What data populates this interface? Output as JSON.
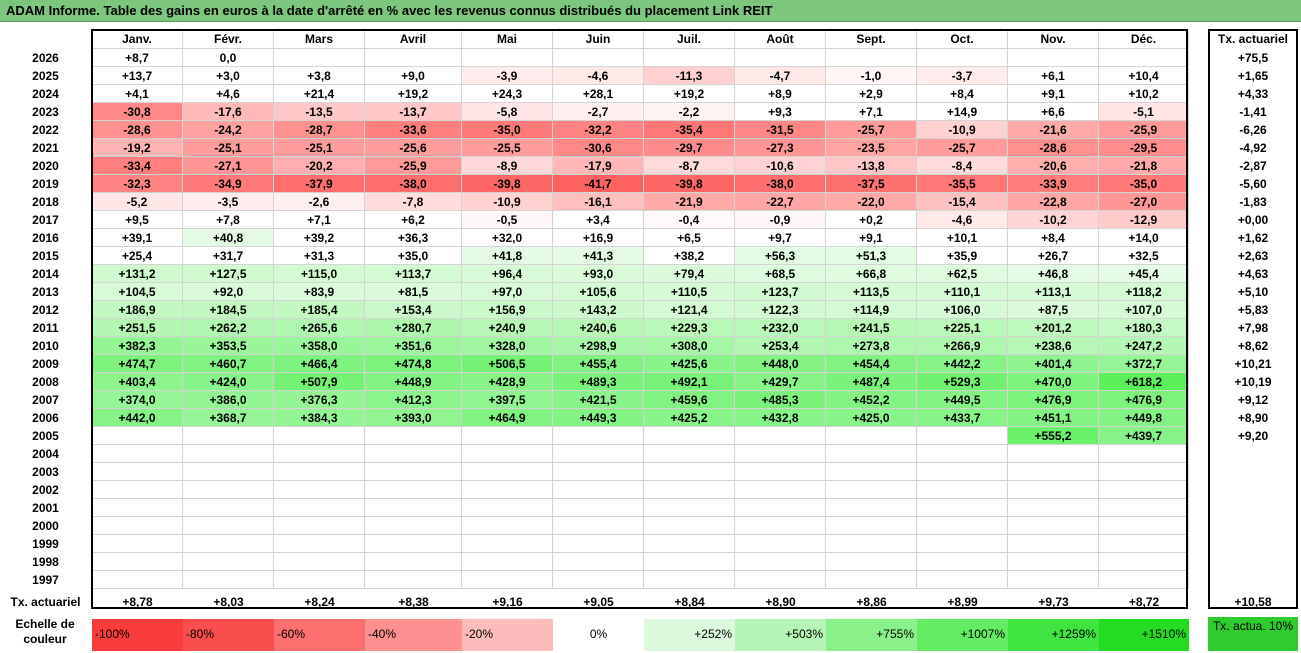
{
  "title": "ADAM Informe. Table des gains en euros à la date d'arrêté en % avec les revenus connus distribués du placement Link REIT",
  "months": [
    "Janv.",
    "Févr.",
    "Mars",
    "Avril",
    "Mai",
    "Juin",
    "Juil.",
    "Août",
    "Sept.",
    "Oct.",
    "Nov.",
    "Déc."
  ],
  "actuarial_header": "Tx. actuariel",
  "row_footer_label": "Tx. actuariel",
  "footer_values": [
    "+8,78",
    "+8,03",
    "+8,24",
    "+8,38",
    "+9,16",
    "+9,05",
    "+8,84",
    "+8,90",
    "+8,86",
    "+8,99",
    "+9,73",
    "+8,72"
  ],
  "footer_actuarial": "+10,58",
  "scale_label": "Echelle de couleur",
  "scale": [
    {
      "label": "-100%",
      "color": "#f83b3b",
      "align": "left"
    },
    {
      "label": "-80%",
      "color": "#fa4e4e",
      "align": "left"
    },
    {
      "label": "-60%",
      "color": "#fb6f6f",
      "align": "left"
    },
    {
      "label": "-40%",
      "color": "#fc8f8f",
      "align": "left"
    },
    {
      "label": "-20%",
      "color": "#fdbcbc",
      "align": "left"
    },
    {
      "label": "0%",
      "color": "#ffffff",
      "align": "center"
    },
    {
      "label": "+252%",
      "color": "#dcf8dc",
      "align": "right"
    },
    {
      "label": "+503%",
      "color": "#b4f4b4",
      "align": "right"
    },
    {
      "label": "+755%",
      "color": "#8af08a",
      "align": "right"
    },
    {
      "label": "+1007%",
      "color": "#63eb63",
      "align": "right"
    },
    {
      "label": "+1259%",
      "color": "#40e440",
      "align": "right"
    },
    {
      "label": "+1510%",
      "color": "#22dd22",
      "align": "right"
    }
  ],
  "legend_green": "Tx. actua. 10%",
  "chart_data": {
    "type": "heatmap",
    "title": "ADAM Informe. Table des gains en euros à la date d'arrêté en % avec les revenus connus distribués du placement Link REIT",
    "columns": [
      "Janv.",
      "Févr.",
      "Mars",
      "Avril",
      "Mai",
      "Juin",
      "Juil.",
      "Août",
      "Sept.",
      "Oct.",
      "Nov.",
      "Déc."
    ],
    "rows": [
      {
        "year": "2026",
        "values": [
          "+8,7",
          "0,0",
          "",
          "",
          "",
          "",
          "",
          "",
          "",
          "",
          "",
          ""
        ],
        "actuarial": "+75,5"
      },
      {
        "year": "2025",
        "values": [
          "+13,7",
          "+3,0",
          "+3,8",
          "+9,0",
          "-3,9",
          "-4,6",
          "-11,3",
          "-4,7",
          "-1,0",
          "-3,7",
          "+6,1",
          "+10,4"
        ],
        "actuarial": "+1,65"
      },
      {
        "year": "2024",
        "values": [
          "+4,1",
          "+4,6",
          "+21,4",
          "+19,2",
          "+24,3",
          "+28,1",
          "+19,2",
          "+8,9",
          "+2,9",
          "+8,4",
          "+9,1",
          "+10,2"
        ],
        "actuarial": "+4,33"
      },
      {
        "year": "2023",
        "values": [
          "-30,8",
          "-17,6",
          "-13,5",
          "-13,7",
          "-5,8",
          "-2,7",
          "-2,2",
          "+9,3",
          "+7,1",
          "+14,9",
          "+6,6",
          "-5,1"
        ],
        "actuarial": "-1,41"
      },
      {
        "year": "2022",
        "values": [
          "-28,6",
          "-24,2",
          "-28,7",
          "-33,6",
          "-35,0",
          "-32,2",
          "-35,4",
          "-31,5",
          "-25,7",
          "-10,9",
          "-21,6",
          "-25,9"
        ],
        "actuarial": "-6,26"
      },
      {
        "year": "2021",
        "values": [
          "-19,2",
          "-25,1",
          "-25,1",
          "-25,6",
          "-25,5",
          "-30,6",
          "-29,7",
          "-27,3",
          "-23,5",
          "-25,7",
          "-28,6",
          "-29,5"
        ],
        "actuarial": "-4,92"
      },
      {
        "year": "2020",
        "values": [
          "-33,4",
          "-27,1",
          "-20,2",
          "-25,9",
          "-8,9",
          "-17,9",
          "-8,7",
          "-10,6",
          "-13,8",
          "-8,4",
          "-20,6",
          "-21,8"
        ],
        "actuarial": "-2,87"
      },
      {
        "year": "2019",
        "values": [
          "-32,3",
          "-34,9",
          "-37,9",
          "-38,0",
          "-39,8",
          "-41,7",
          "-39,8",
          "-38,0",
          "-37,5",
          "-35,5",
          "-33,9",
          "-35,0"
        ],
        "actuarial": "-5,60"
      },
      {
        "year": "2018",
        "values": [
          "-5,2",
          "-3,5",
          "-2,6",
          "-7,8",
          "-10,9",
          "-16,1",
          "-21,9",
          "-22,7",
          "-22,0",
          "-15,4",
          "-22,8",
          "-27,0"
        ],
        "actuarial": "-1,83"
      },
      {
        "year": "2017",
        "values": [
          "+9,5",
          "+7,8",
          "+7,1",
          "+6,2",
          "-0,5",
          "+3,4",
          "-0,4",
          "-0,9",
          "+0,2",
          "-4,6",
          "-10,2",
          "-12,9"
        ],
        "actuarial": "+0,00"
      },
      {
        "year": "2016",
        "values": [
          "+39,1",
          "+40,8",
          "+39,2",
          "+36,3",
          "+32,0",
          "+16,9",
          "+6,5",
          "+9,7",
          "+9,1",
          "+10,1",
          "+8,4",
          "+14,0"
        ],
        "actuarial": "+1,62"
      },
      {
        "year": "2015",
        "values": [
          "+25,4",
          "+31,7",
          "+31,3",
          "+35,0",
          "+41,8",
          "+41,3",
          "+38,2",
          "+56,3",
          "+51,3",
          "+35,9",
          "+26,7",
          "+32,5"
        ],
        "actuarial": "+2,63"
      },
      {
        "year": "2014",
        "values": [
          "+131,2",
          "+127,5",
          "+115,0",
          "+113,7",
          "+96,4",
          "+93,0",
          "+79,4",
          "+68,5",
          "+66,8",
          "+62,5",
          "+46,8",
          "+45,4"
        ],
        "actuarial": "+4,63"
      },
      {
        "year": "2013",
        "values": [
          "+104,5",
          "+92,0",
          "+83,9",
          "+81,5",
          "+97,0",
          "+105,6",
          "+110,5",
          "+123,7",
          "+113,5",
          "+110,1",
          "+113,1",
          "+118,2"
        ],
        "actuarial": "+5,10"
      },
      {
        "year": "2012",
        "values": [
          "+186,9",
          "+184,5",
          "+185,4",
          "+153,4",
          "+156,9",
          "+143,2",
          "+121,4",
          "+122,3",
          "+114,9",
          "+106,0",
          "+87,5",
          "+107,0"
        ],
        "actuarial": "+5,83"
      },
      {
        "year": "2011",
        "values": [
          "+251,5",
          "+262,2",
          "+265,6",
          "+280,7",
          "+240,9",
          "+240,6",
          "+229,3",
          "+232,0",
          "+241,5",
          "+225,1",
          "+201,2",
          "+180,3"
        ],
        "actuarial": "+7,98"
      },
      {
        "year": "2010",
        "values": [
          "+382,3",
          "+353,5",
          "+358,0",
          "+351,6",
          "+328,0",
          "+298,9",
          "+308,0",
          "+253,4",
          "+273,8",
          "+266,9",
          "+238,6",
          "+247,2"
        ],
        "actuarial": "+8,62"
      },
      {
        "year": "2009",
        "values": [
          "+474,7",
          "+460,7",
          "+466,4",
          "+474,8",
          "+506,5",
          "+455,4",
          "+425,6",
          "+448,0",
          "+454,4",
          "+442,2",
          "+401,4",
          "+372,7"
        ],
        "actuarial": "+10,21"
      },
      {
        "year": "2008",
        "values": [
          "+403,4",
          "+424,0",
          "+507,9",
          "+448,9",
          "+428,9",
          "+489,3",
          "+492,1",
          "+429,7",
          "+487,4",
          "+529,3",
          "+470,0",
          "+618,2"
        ],
        "actuarial": "+10,19"
      },
      {
        "year": "2007",
        "values": [
          "+374,0",
          "+386,0",
          "+376,3",
          "+412,3",
          "+397,5",
          "+421,5",
          "+459,6",
          "+485,3",
          "+452,2",
          "+449,5",
          "+476,9",
          "+476,9"
        ],
        "actuarial": "+9,12"
      },
      {
        "year": "2006",
        "values": [
          "+442,0",
          "+368,7",
          "+384,3",
          "+393,0",
          "+464,9",
          "+449,3",
          "+425,2",
          "+432,8",
          "+425,0",
          "+433,7",
          "+451,1",
          "+449,8"
        ],
        "actuarial": "+8,90"
      },
      {
        "year": "2005",
        "values": [
          "",
          "",
          "",
          "",
          "",
          "",
          "",
          "",
          "",
          "",
          "+555,2",
          "+439,7"
        ],
        "actuarial": "+9,20"
      },
      {
        "year": "2004",
        "values": [
          "",
          "",
          "",
          "",
          "",
          "",
          "",
          "",
          "",
          "",
          "",
          ""
        ],
        "actuarial": ""
      },
      {
        "year": "2003",
        "values": [
          "",
          "",
          "",
          "",
          "",
          "",
          "",
          "",
          "",
          "",
          "",
          ""
        ],
        "actuarial": ""
      },
      {
        "year": "2002",
        "values": [
          "",
          "",
          "",
          "",
          "",
          "",
          "",
          "",
          "",
          "",
          "",
          ""
        ],
        "actuarial": ""
      },
      {
        "year": "2001",
        "values": [
          "",
          "",
          "",
          "",
          "",
          "",
          "",
          "",
          "",
          "",
          "",
          ""
        ],
        "actuarial": ""
      },
      {
        "year": "2000",
        "values": [
          "",
          "",
          "",
          "",
          "",
          "",
          "",
          "",
          "",
          "",
          "",
          ""
        ],
        "actuarial": ""
      },
      {
        "year": "1999",
        "values": [
          "",
          "",
          "",
          "",
          "",
          "",
          "",
          "",
          "",
          "",
          "",
          ""
        ],
        "actuarial": ""
      },
      {
        "year": "1998",
        "values": [
          "",
          "",
          "",
          "",
          "",
          "",
          "",
          "",
          "",
          "",
          "",
          ""
        ],
        "actuarial": ""
      },
      {
        "year": "1997",
        "values": [
          "",
          "",
          "",
          "",
          "",
          "",
          "",
          "",
          "",
          "",
          "",
          ""
        ],
        "actuarial": ""
      }
    ]
  }
}
